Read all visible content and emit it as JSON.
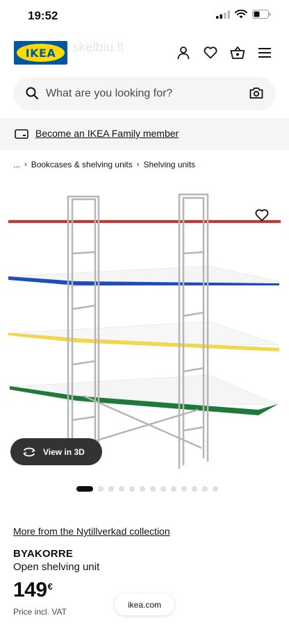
{
  "status_bar": {
    "time": "19:52",
    "icons": [
      "signal-icon",
      "wifi-icon",
      "battery-icon"
    ]
  },
  "header": {
    "logo_text": "IKEA",
    "watermark": "skelbiu.lt",
    "icons": [
      "user-icon",
      "heart-icon",
      "basket-icon",
      "menu-icon"
    ]
  },
  "search": {
    "placeholder": "What are you looking for?",
    "icon": "search-icon",
    "camera_icon": "camera-icon"
  },
  "family": {
    "label": "Become an IKEA Family member",
    "icon": "card-icon"
  },
  "breadcrumb": {
    "items": [
      "...",
      "Bookcases & shelving units",
      "Shelving units"
    ]
  },
  "gallery": {
    "view3d_label": "View in 3D",
    "image_count": 13,
    "active_index": 0,
    "shelf_colors": [
      "#c0392b",
      "#1e4fb8",
      "#f2d64b",
      "#1f7a3a"
    ]
  },
  "product": {
    "collection_link": "More from the Nytillverkad collection",
    "name": "BYAKORRE",
    "description": "Open shelving unit",
    "price": "149",
    "currency": "€",
    "price_note": "Price incl. VAT"
  },
  "browser": {
    "url": "ikea.com"
  },
  "colors": {
    "brand_blue": "#0058a3",
    "brand_yellow": "#ffdb00"
  }
}
